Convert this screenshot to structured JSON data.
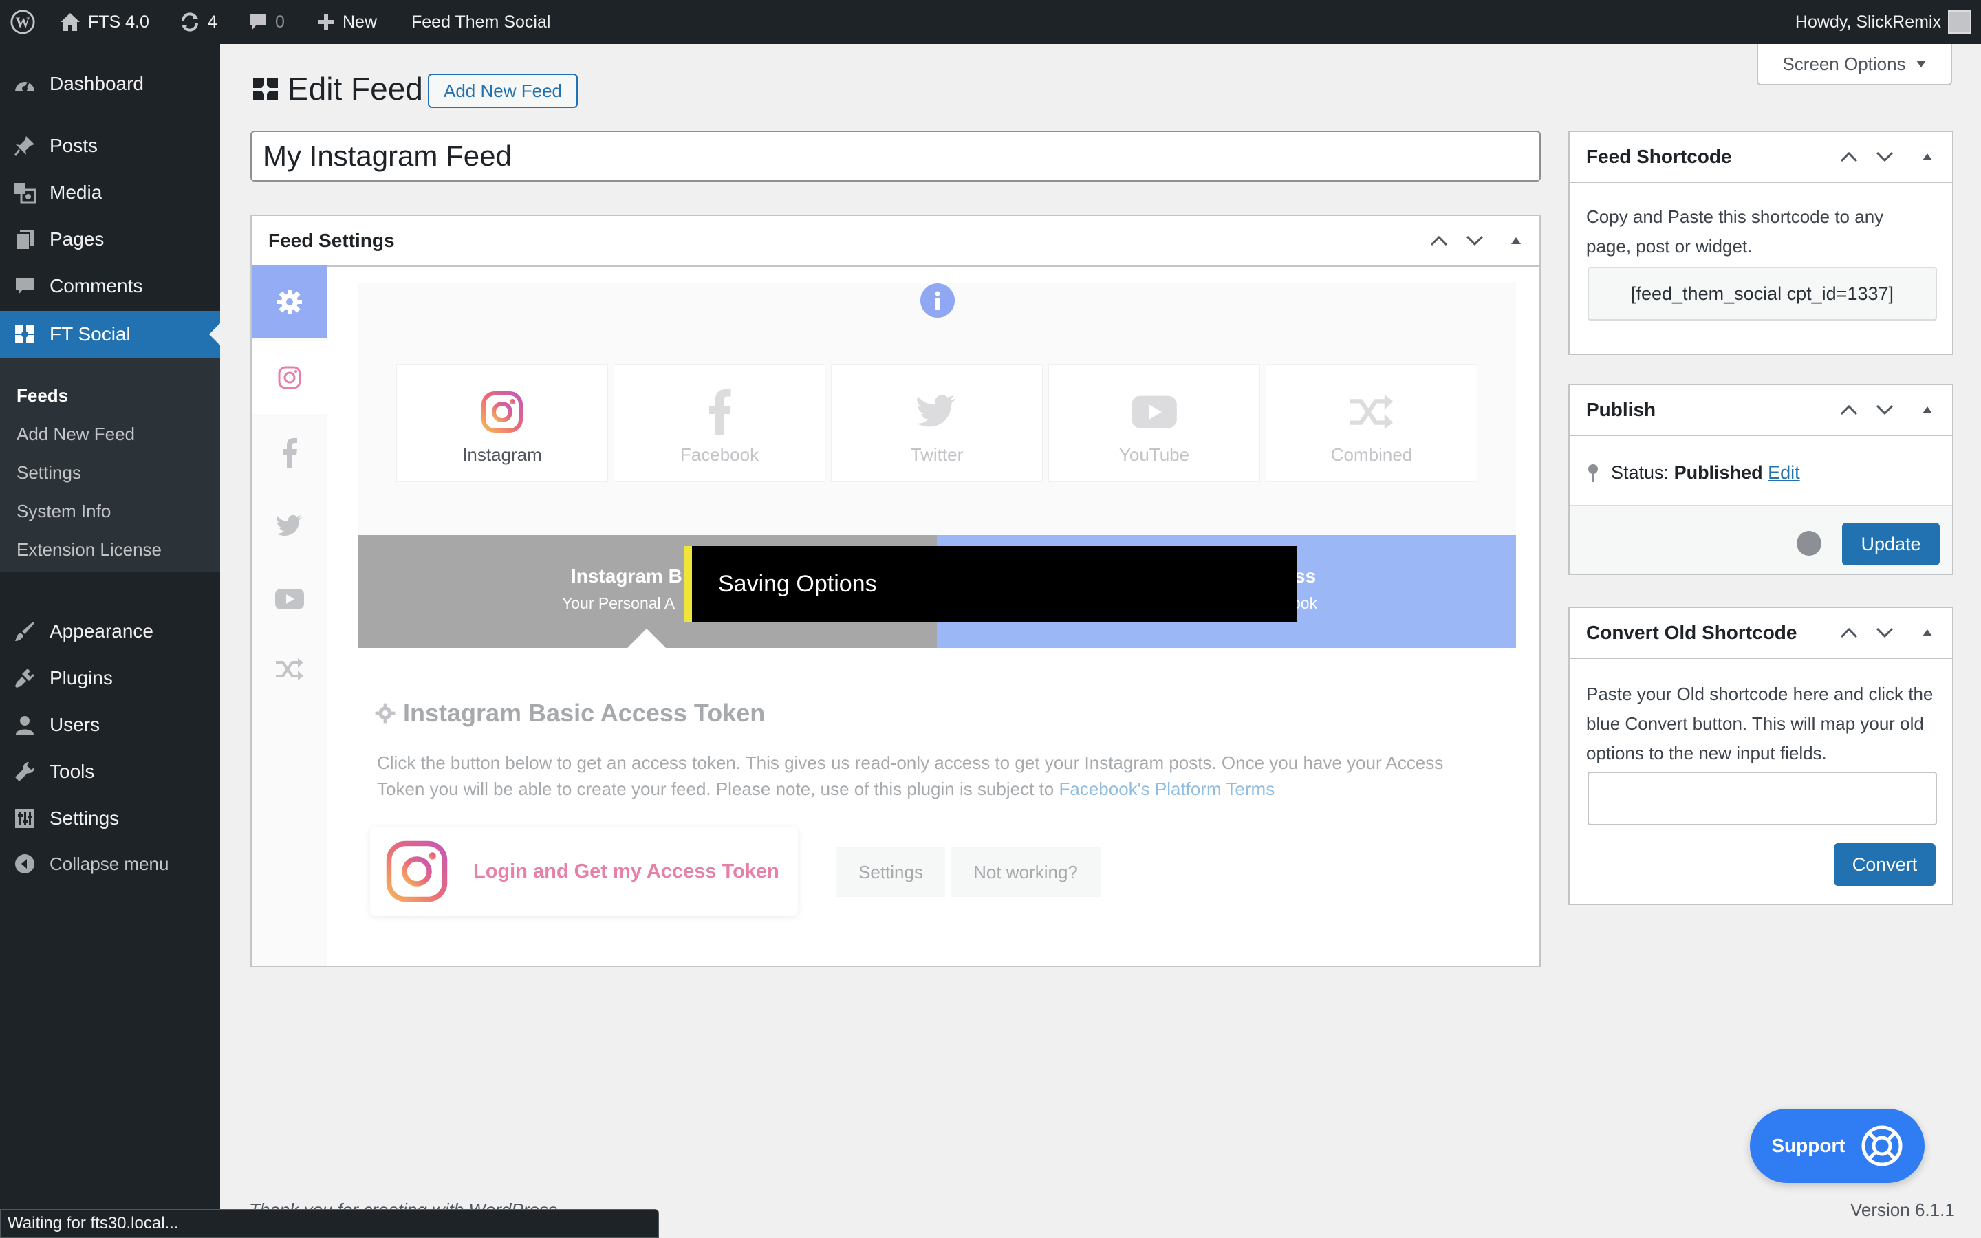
{
  "admin_bar": {
    "site_name": "FTS 4.0",
    "updates_count": "4",
    "comments_count": "0",
    "new_label": "New",
    "plugin_label": "Feed Them Social",
    "howdy": "Howdy, SlickRemix"
  },
  "sidebar": {
    "dashboard": "Dashboard",
    "posts": "Posts",
    "media": "Media",
    "pages": "Pages",
    "comments": "Comments",
    "ft_social": "FT Social",
    "submenu": [
      "Feeds",
      "Add New Feed",
      "Settings",
      "System Info",
      "Extension License"
    ],
    "appearance": "Appearance",
    "plugins": "Plugins",
    "users": "Users",
    "tools": "Tools",
    "settings": "Settings",
    "collapse": "Collapse menu"
  },
  "page": {
    "title": "Edit Feed",
    "add_new_button": "Add New Feed",
    "screen_options": "Screen Options",
    "feed_title_value": "My Instagram Feed"
  },
  "feed_settings": {
    "title": "Feed Settings",
    "tabs": [
      "Instagram",
      "Facebook",
      "Twitter",
      "YouTube",
      "Combined"
    ],
    "banner_left_title": "Instagram B",
    "banner_left_sub": "Your Personal A",
    "banner_right_title": "ss",
    "banner_right_sub": "ook",
    "saving_notice": "Saving Options",
    "section_title": "Instagram Basic Access Token",
    "description": "Click the button below to get an access token. This gives us read-only access to get your Instagram posts. Once you have your Access Token you will be able to create your feed. Please note, use of this plugin is subject to",
    "terms_link": "Facebook's Platform Terms",
    "login_button": "Login and Get my Access Token",
    "settings_button": "Settings",
    "not_working_button": "Not working?"
  },
  "shortcode_box": {
    "title": "Feed Shortcode",
    "text": "Copy and Paste this shortcode to any page, post or widget.",
    "shortcode": "[feed_them_social cpt_id=1337]"
  },
  "publish_box": {
    "title": "Publish",
    "status_label": "Status:",
    "status_value": "Published",
    "edit_link": "Edit",
    "update_button": "Update"
  },
  "convert_box": {
    "title": "Convert Old Shortcode",
    "text": "Paste your Old shortcode here and click the blue Convert button. This will map your old options to the new input fields.",
    "input_value": "",
    "convert_button": "Convert"
  },
  "footer": {
    "thanks": "Thank you for creating with WordPress.",
    "version": "Version 6.1.1",
    "support_button": "Support",
    "status_bar": "Waiting for fts30.local..."
  },
  "colors": {
    "admin_dark": "#1d2327",
    "wp_blue": "#2271b1",
    "support_blue": "#2f7cf3",
    "banner_grey": "#a7a7a7",
    "banner_blue": "#9bb7f6",
    "instagram_pink": "#e77fa7",
    "info_blue": "#90a8f4",
    "saving_highlight": "#f0e53a"
  }
}
